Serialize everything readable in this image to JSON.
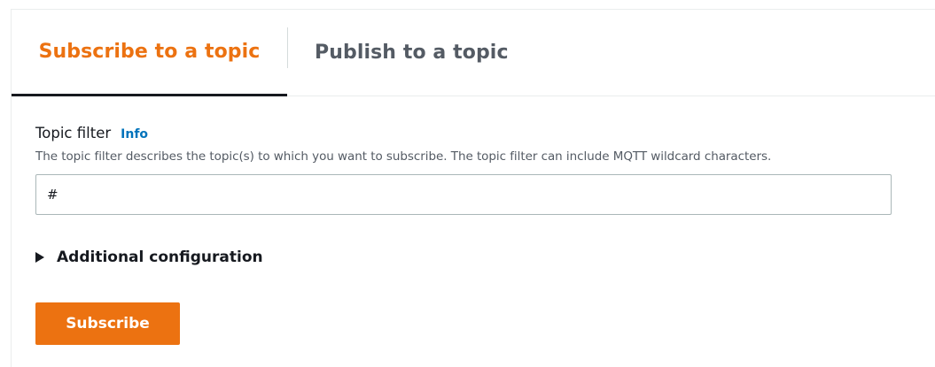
{
  "tabs": {
    "subscribe_label": "Subscribe to a topic",
    "publish_label": "Publish to a topic",
    "active": "subscribe"
  },
  "form": {
    "topic_filter_label": "Topic filter",
    "info_label": "Info",
    "topic_filter_description": "The topic filter describes the topic(s) to which you want to subscribe. The topic filter can include MQTT wildcard characters.",
    "topic_filter_value": "#",
    "additional_config_label": "Additional configuration",
    "subscribe_button_label": "Subscribe"
  },
  "colors": {
    "accent": "#ec7211",
    "link": "#0073bb",
    "text": "#16191f",
    "muted_text": "#545b64"
  },
  "icons": {
    "expander": "caret-right-icon"
  }
}
